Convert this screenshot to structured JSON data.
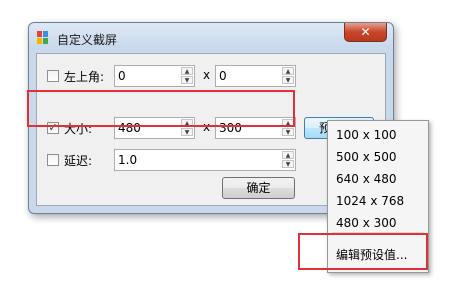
{
  "window": {
    "title": "自定义截屏",
    "close_glyph": "✕"
  },
  "rows": [
    {
      "checked": false,
      "label": "左上角:",
      "value1": "0",
      "sep": "x",
      "value2": "0"
    },
    {
      "checked": true,
      "label": "大小:",
      "value1": "480",
      "sep": "x",
      "value2": "300"
    },
    {
      "checked": false,
      "label": "延迟:",
      "value1": "1.0"
    }
  ],
  "check_glyph": "✓",
  "spin_up": "▲",
  "spin_down": "▼",
  "preset_button": {
    "label": "预设",
    "arrow": "▼"
  },
  "ok_button": {
    "label": "确定"
  },
  "preset_menu": {
    "items": [
      "100 x 100",
      "500 x 500",
      "640 x 480",
      "1024 x 768",
      "480 x 300"
    ],
    "edit_item": "编辑预设值..."
  },
  "colors": {
    "highlight": "#e0303a",
    "close_button": "#c8462b"
  }
}
